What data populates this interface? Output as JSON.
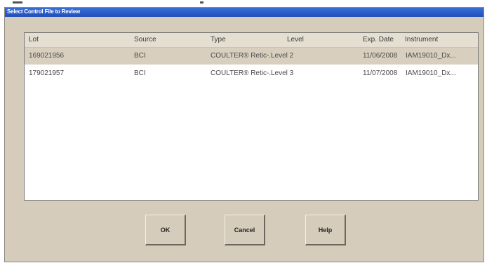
{
  "window": {
    "title": "Select Control File to Review"
  },
  "table": {
    "headers": [
      "Lot",
      "Source",
      "Type",
      "Level",
      "Exp. Date",
      "Instrument"
    ],
    "rows": [
      {
        "lot": "169021956",
        "source": "BCI",
        "type": "COULTER® Retic-...",
        "level": "Level 2",
        "exp_date": "11/06/2008",
        "instrument": "IAM19010_Dx..."
      },
      {
        "lot": "179021957",
        "source": "BCI",
        "type": "COULTER® Retic-...",
        "level": "Level 3",
        "exp_date": "11/07/2008",
        "instrument": "IAM19010_Dx..."
      }
    ]
  },
  "buttons": {
    "ok": "OK",
    "cancel": "Cancel",
    "help": "Help"
  }
}
